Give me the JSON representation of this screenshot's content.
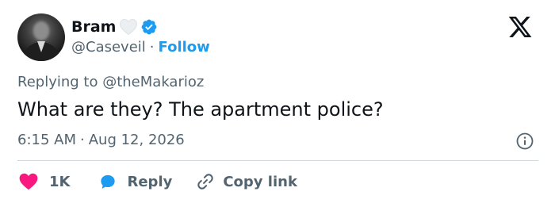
{
  "author": {
    "name": "Bram",
    "handle": "@Caseveil",
    "separator": "·",
    "follow_label": "Follow"
  },
  "tweet": {
    "replying_prefix": "Replying to",
    "replying_to": "@theMakarioz",
    "text": "What are they? The apartment police?",
    "time": "6:15 AM",
    "separator": "·",
    "date": "Aug 12, 2026"
  },
  "actions": {
    "like_count": "1K",
    "reply_label": "Reply",
    "copy_label": "Copy link"
  },
  "icons": {
    "name_emoji": "white-heart-icon",
    "verified": "verified-badge-icon",
    "platform": "x-logo-icon",
    "info": "info-icon",
    "like": "heart-icon",
    "reply": "reply-bubble-icon",
    "copy": "link-icon"
  },
  "colors": {
    "accent": "#1d9bf0",
    "like": "#f91880",
    "text": "#0f1419",
    "secondary": "#536471",
    "divider": "#cfd9de"
  }
}
